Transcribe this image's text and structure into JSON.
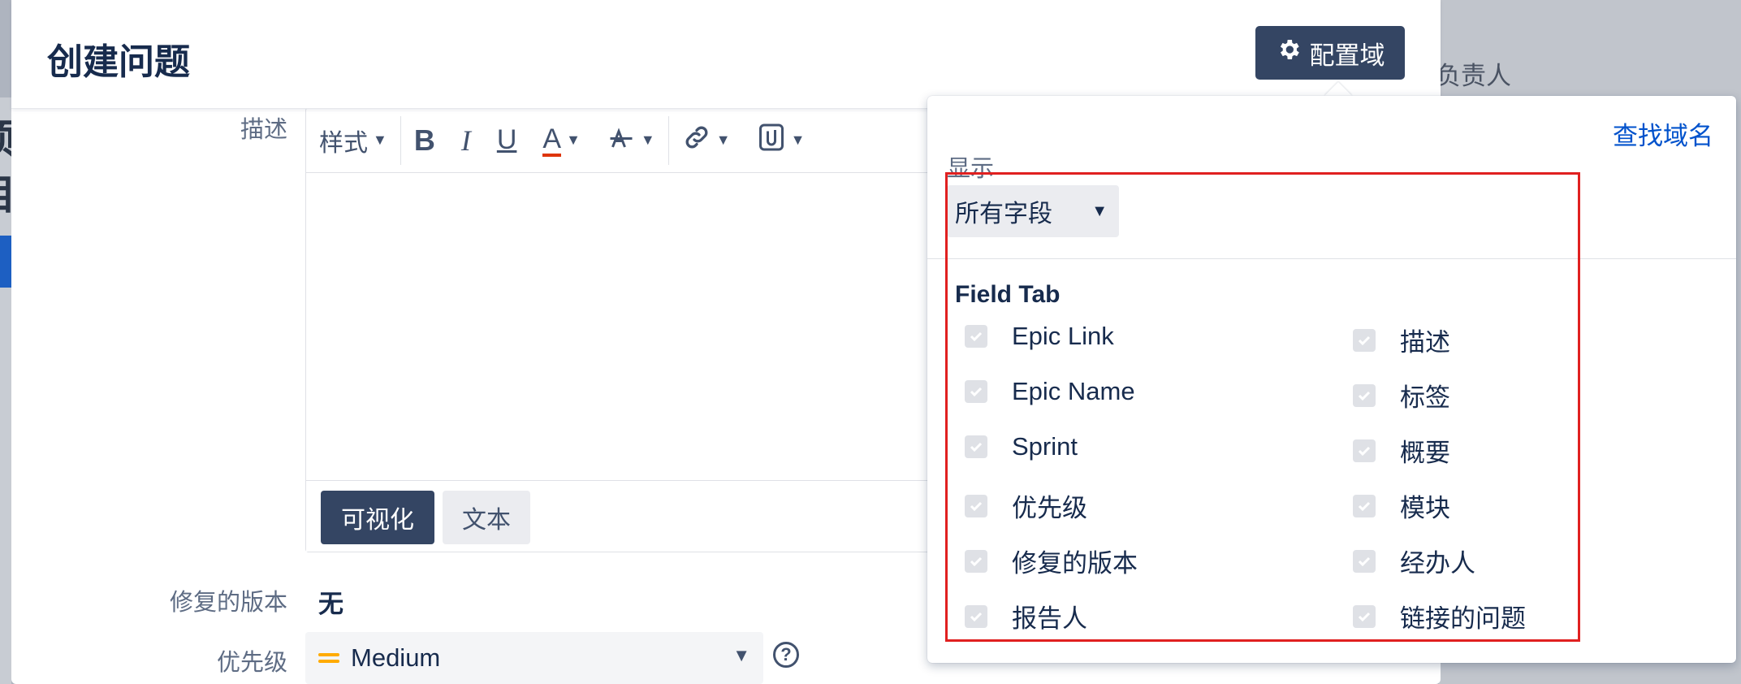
{
  "background": {
    "right_text": "负责人",
    "left_glyphs": [
      "项",
      "目"
    ]
  },
  "dialog": {
    "title": "创建问题",
    "config_button_label": "配置域"
  },
  "form": {
    "description_label": "描述",
    "toolbar": {
      "style_label": "样式",
      "bold": "B",
      "italic": "I",
      "underline": "U",
      "text_color": "A"
    },
    "mode_visual": "可视化",
    "mode_text": "文本",
    "fix_version_label": "修复的版本",
    "fix_version_value": "无",
    "priority_label": "优先级",
    "priority_value": "Medium"
  },
  "popup": {
    "find_link": "查找域名",
    "show_label": "显示",
    "show_select_value": "所有字段",
    "tab_heading": "Field Tab",
    "left_fields": [
      "Epic Link",
      "Epic Name",
      "Sprint",
      "优先级",
      "修复的版本",
      "报告人"
    ],
    "right_fields": [
      "描述",
      "标签",
      "概要",
      "模块",
      "经办人",
      "链接的问题"
    ]
  },
  "colors": {
    "primary_dark": "#344563",
    "link": "#0052cc",
    "highlight": "#e02020",
    "priority_medium": "#ffab00"
  }
}
